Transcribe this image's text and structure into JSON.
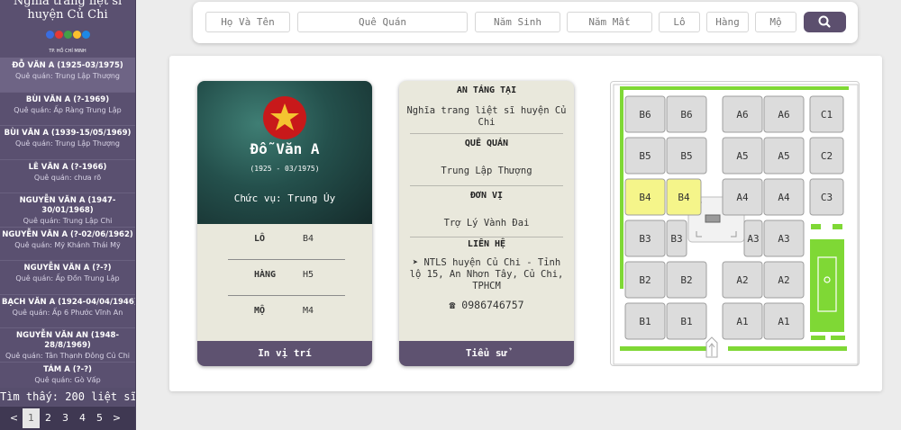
{
  "sidebar": {
    "title_line1": "Nghĩa trang liệt sĩ",
    "title_line2": "huyện Củ Chi",
    "logo_caption": "TP. HỒ CHÍ MINH",
    "items": [
      {
        "name": "ĐỖ VĂN A (1925-03/1975)",
        "origin": "Quê quán: Trung Lập Thượng"
      },
      {
        "name": "BÙI VĂN A (?-1969)",
        "origin": "Quê quán: Ấp Ràng Trung Lập"
      },
      {
        "name": "BÙI VĂN A (1939-15/05/1969)",
        "origin": "Quê quán: Trung Lập Thượng"
      },
      {
        "name": "LÊ VĂN A (?-1966)",
        "origin": "Quê quán: chưa rõ"
      },
      {
        "name_line1": "NGUYỄN VĂN A (1947-",
        "name_line2": "30/01/1968)",
        "origin": "Quê quán: Trung Lập Chi"
      },
      {
        "name": "NGUYỄN VĂN A (?-02/06/1962)",
        "origin": "Quê quán: Mỹ Khánh Thái Mỹ"
      },
      {
        "name": "NGUYỄN VĂN A (?-?)",
        "origin": "Quê quán: Ấp Đồn Trung Lập"
      },
      {
        "name": "BẠCH VĂN A (1924-04/04/1946)",
        "origin": "Quê quán: Ấp 6 Phước Vĩnh An"
      },
      {
        "name_line1": "NGUYỄN VĂN AN (1948-",
        "name_line2": "28/8/1969)",
        "origin": "Quê quán: Tân Thạnh Đông Củ Chi"
      },
      {
        "name": "TÁM A (?-?)",
        "origin": "Quê quán: Gò Vấp"
      }
    ],
    "found_text": "Tìm thấy: 200 liệt sĩ",
    "pager": {
      "prev": "<",
      "pages": [
        "1",
        "2",
        "3",
        "4",
        "5"
      ],
      "next": ">"
    }
  },
  "search": {
    "fields": [
      "Họ Và Tên",
      "Quê Quán",
      "Năm Sinh",
      "Năm Mất",
      "Lô",
      "Hàng",
      "Mộ"
    ],
    "button_icon": "search-icon"
  },
  "profile": {
    "name": "Đỗ Văn A",
    "years": "(1925 - 03/1975)",
    "rank": "Chức vụ: Trung Úy",
    "rows": [
      {
        "label": "LÔ",
        "value": "B4"
      },
      {
        "label": "HÀNG",
        "value": "H5"
      },
      {
        "label": "MỘ",
        "value": "M4"
      }
    ],
    "button": "In vị trí"
  },
  "info": {
    "buried_title": "AN TÁNG TẠI",
    "buried_value": "Nghĩa trang liệt sĩ huyện Củ Chi",
    "origin_title": "QUÊ QUÁN",
    "origin_value": "Trung Lập Thượng",
    "unit_title": "ĐƠN VỊ",
    "unit_value": "Trợ Lý Vành Đai",
    "contact_title": "LIÊN HỆ",
    "contact_address": "➤ NTLS huyện Củ Chi - Tỉnh lộ 15, An Nhơn Tây, Củ Chi, TPHCM",
    "contact_phone": "☎ 0986746757",
    "button": "Tiểu sử"
  },
  "map": {
    "plots": [
      {
        "label": "B6",
        "highlight": false
      },
      {
        "label": "B6",
        "highlight": false
      },
      {
        "label": "A6",
        "highlight": false
      },
      {
        "label": "A6",
        "highlight": false
      },
      {
        "label": "C1",
        "highlight": false
      },
      {
        "label": "B5",
        "highlight": false
      },
      {
        "label": "B5",
        "highlight": false
      },
      {
        "label": "A5",
        "highlight": false
      },
      {
        "label": "A5",
        "highlight": false
      },
      {
        "label": "C2",
        "highlight": false
      },
      {
        "label": "B4",
        "highlight": true
      },
      {
        "label": "B4",
        "highlight": true
      },
      {
        "label": "A4",
        "highlight": false
      },
      {
        "label": "A4",
        "highlight": false
      },
      {
        "label": "C3",
        "highlight": false
      },
      {
        "label": "B3",
        "highlight": false
      },
      {
        "label": "B3",
        "highlight": false
      },
      {
        "label": "A3",
        "highlight": false
      },
      {
        "label": "A3",
        "highlight": false
      },
      {
        "label": "B2",
        "highlight": false
      },
      {
        "label": "B2",
        "highlight": false
      },
      {
        "label": "A2",
        "highlight": false
      },
      {
        "label": "A2",
        "highlight": false
      },
      {
        "label": "B1",
        "highlight": false
      },
      {
        "label": "B1",
        "highlight": false
      },
      {
        "label": "A1",
        "highlight": false
      },
      {
        "label": "A1",
        "highlight": false
      }
    ],
    "colors": {
      "plot": "#dcdcdc",
      "highlight": "#f5f58a",
      "green": "#7fd835"
    }
  },
  "colors": {
    "sidebar": "#5a5070",
    "accent": "#5e5270",
    "card": "#e9e8dc"
  }
}
